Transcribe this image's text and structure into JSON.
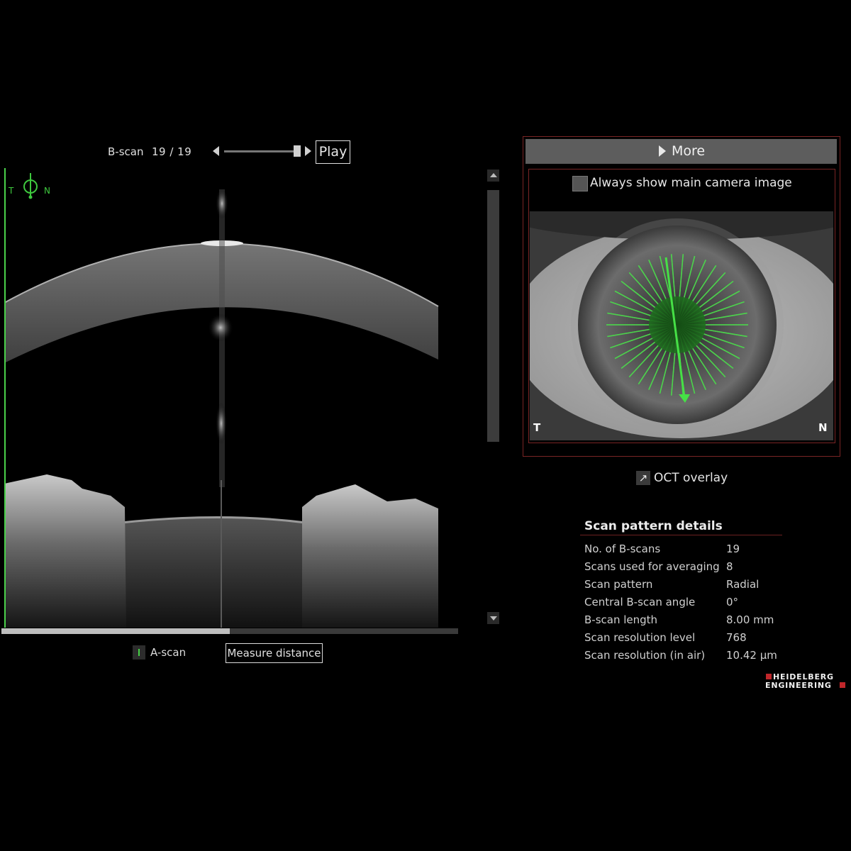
{
  "bscan": {
    "label": "B-scan",
    "counter": "19 / 19",
    "current": 19,
    "total": 19,
    "play_label": "Play"
  },
  "orientation": {
    "left": "T",
    "right": "N"
  },
  "horizontal_scroll_fraction": 0.5,
  "controls": {
    "ascan_label": "A-scan",
    "measure_label": "Measure distance"
  },
  "panel": {
    "more_label": "More",
    "always_show_label": "Always show main camera image",
    "camera_label_left": "T",
    "camera_label_right": "N",
    "oct_overlay_label": "OCT overlay"
  },
  "details": {
    "title": "Scan pattern details",
    "rows": [
      {
        "key": "No. of B-scans",
        "value": "19"
      },
      {
        "key": "Scans used for averaging",
        "value": "8"
      },
      {
        "key": "Scan pattern",
        "value": "Radial"
      },
      {
        "key": "Central B-scan angle",
        "value": "0°"
      },
      {
        "key": "B-scan length",
        "value": "8.00 mm"
      },
      {
        "key": "Scan resolution level",
        "value": "768"
      },
      {
        "key": "Scan resolution (in air)",
        "value": "10.42 µm"
      }
    ]
  },
  "logo": {
    "line1": "HEIDELBERG",
    "line2": "ENGINEERING"
  },
  "colors": {
    "accent_green": "#4bd14b",
    "panel_border": "#7a2525",
    "logo_red": "#c0262a"
  },
  "icons": [
    "previous-arrow-icon",
    "next-arrow-icon",
    "orientation-icon",
    "oct-overlay-arrow-icon"
  ]
}
